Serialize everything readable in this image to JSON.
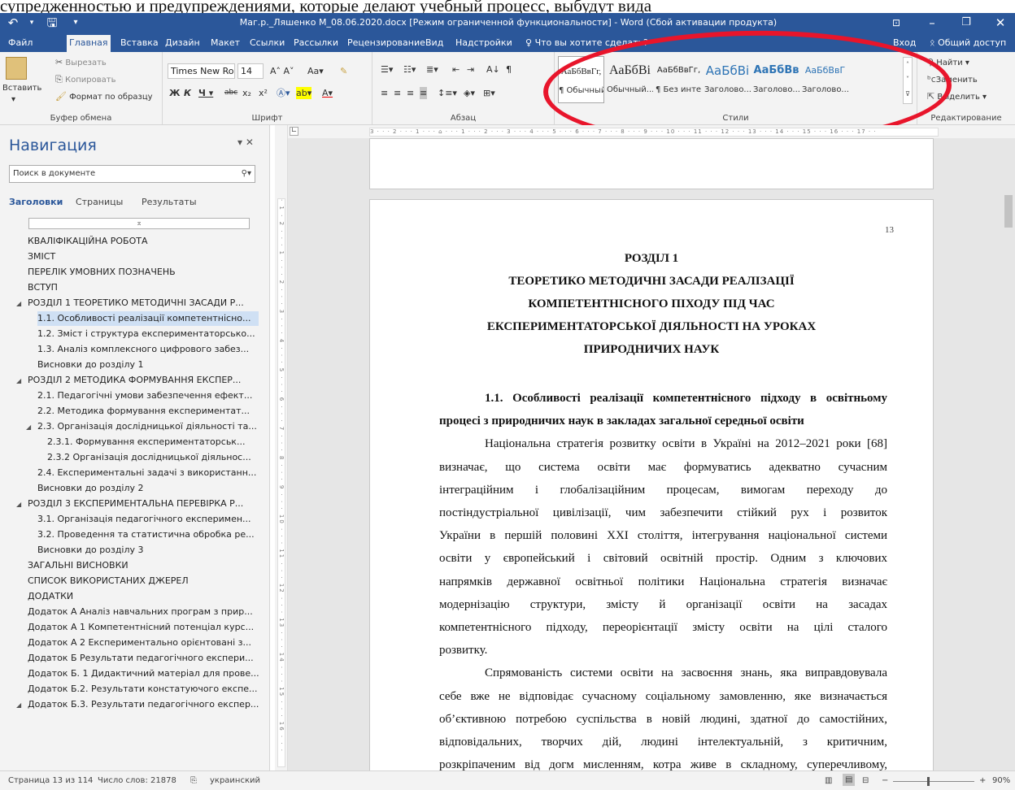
{
  "overlay_text": "супредженностью и предупреждениями, которые делают учебный процесс, выбудут вида",
  "titlebar": {
    "title": "Маг.р._Ляшенко М_08.06.2020.docx [Режим ограниченной функциональности] - Word (Сбой активации продукта)"
  },
  "tabs": [
    {
      "label": "Файл"
    },
    {
      "label": "Главная"
    },
    {
      "label": "Вставка"
    },
    {
      "label": "Дизайн"
    },
    {
      "label": "Макет"
    },
    {
      "label": "Ссылки"
    },
    {
      "label": "Рассылки"
    },
    {
      "label": "Рецензирование"
    },
    {
      "label": "Вид"
    },
    {
      "label": "Надстройки"
    }
  ],
  "tell_me": "Что вы хотите сделать?",
  "signin": "Вход",
  "share": "Общий доступ",
  "clipboard": {
    "cut": "Вырезать",
    "copy": "Копировать",
    "paste": "Вставить",
    "format_painter": "Формат по образцу",
    "label": "Буфер обмена"
  },
  "font": {
    "name": "Times New Ro",
    "size": "14",
    "label": "Шрифт"
  },
  "paragraph": {
    "label": "Абзац"
  },
  "styles": {
    "label": "Стили",
    "items": [
      {
        "preview": "АаБбВвГг,",
        "name": "¶ Обычный"
      },
      {
        "preview": "АаБбВі",
        "name": "Обычный..."
      },
      {
        "preview": "АаБбВвГг,",
        "name": "¶ Без инте..."
      },
      {
        "preview": "АаБбВі",
        "name": "Заголово..."
      },
      {
        "preview": "АаБбВв",
        "name": "Заголово..."
      },
      {
        "preview": "АаБбВвГ",
        "name": "Заголово..."
      }
    ]
  },
  "editing": {
    "find": "Найти",
    "replace": "Заменить",
    "select": "Выделить",
    "label": "Редактирование"
  },
  "nav": {
    "title": "Навигация",
    "search_placeholder": "Поиск в документе",
    "tabs": [
      "Заголовки",
      "Страницы",
      "Результаты"
    ],
    "items": [
      "КВАЛІФІКАЦІЙНА РОБОТА",
      "ЗМІСТ",
      "ПЕРЕЛІК УМОВНИХ ПОЗНАЧЕНЬ",
      "ВСТУП",
      "РОЗДІЛ 1 ТЕОРЕТИКО МЕТОДИЧНІ ЗАСАДИ Р...",
      "1.1. Особливості реалізації компетентнісно...",
      "1.2. Зміст і структура експериментаторсько...",
      "1.3. Аналіз комплексного цифрового забез...",
      "Висновки до розділу 1",
      "РОЗДІЛ 2 МЕТОДИКА ФОРМУВАННЯ ЕКСПЕР...",
      "2.1. Педагогічні умови забезпечення ефект...",
      "2.2. Методика формування експериментат...",
      "2.3. Організація дослідницької діяльності та...",
      "2.3.1. Формування експериментаторськ...",
      "2.3.2 Організація дослідницької діяльнос...",
      "2.4. Експериментальні задачі з використанн...",
      "Висновки до розділу 2",
      "РОЗДІЛ 3 ЕКСПЕРИМЕНТАЛЬНА ПЕРЕВІРКА Р...",
      "3.1. Організація педагогічного експеримен...",
      "3.2. Проведення та статистична обробка ре...",
      "Висновки до розділу 3",
      "ЗАГАЛЬНІ ВИСНОВКИ",
      "СПИСОК ВИКОРИСТАНИХ ДЖЕРЕЛ",
      "ДОДАТКИ",
      "Додаток А Аналіз навчальних програм з прир...",
      "Додаток А 1 Компетентнісний потенціал курс...",
      "Додаток А 2 Експериментально орієнтовані з...",
      "Додаток Б Результати педагогічного експери...",
      "Додаток Б. 1 Дидактичний матеріал для прове...",
      "Додаток Б.2. Результати констатуючого експе...",
      "Додаток Б.3. Результати педагогічного експер..."
    ]
  },
  "document": {
    "page_number": "13",
    "title_lines": [
      "РОЗДІЛ 1",
      "ТЕОРЕТИКО МЕТОДИЧНІ ЗАСАДИ РЕАЛІЗАЦІЇ",
      "КОМПЕТЕНТНІСНОГО ПІХОДУ ПІД ЧАС",
      "ЕКСПЕРИМЕНТАТОРСЬКОЇ ДІЯЛЬНОСТІ НА УРОКАХ",
      "ПРИРОДНИЧИХ НАУК"
    ],
    "lines": [
      "1.1. Особливості реалізації компетентнісного підходу в освітньому",
      "процесі з природничих наук в закладах загальної середньої освіти",
      "Національна стратегія розвитку освіти в Україні на 2012–2021 роки [68]",
      "визначає, що система освіти має формуватись адекватно сучасним",
      "інтеграційним і глобалізаційним процесам, вимогам переходу до",
      "постіндустріальної цивілізації, чим забезпечити стійкий рух і розвиток",
      "України в першій половині XXI століття, інтегрування національної системи",
      "освіти у європейський і світовий освітній простір. Одним з ключових",
      "напрямків державної освітньої політики Національна стратегія визначає",
      "модернізацію структури, змісту й організації освіти на засадах",
      "компетентнісного підходу, переорієнтації змісту освіти на цілі сталого",
      "розвитку.",
      "Спрямованість системи освіти на засвоєння знань, яка виправдовувала",
      "себе вже не відповідає сучасному соціальному замовленню, яке визначається",
      "об’єктивною потребою суспільства в новій людині, здатної до самостійних,",
      "відповідальних, творчих дій, людині інтелектуальній, з критичним,",
      "розкріпаченим від догм мисленням, котра живе в складному, суперечливому,"
    ]
  },
  "status": {
    "page": "Страница 13 из 114",
    "words": "Число слов: 21878",
    "language": "украинский",
    "zoom": "90%"
  }
}
